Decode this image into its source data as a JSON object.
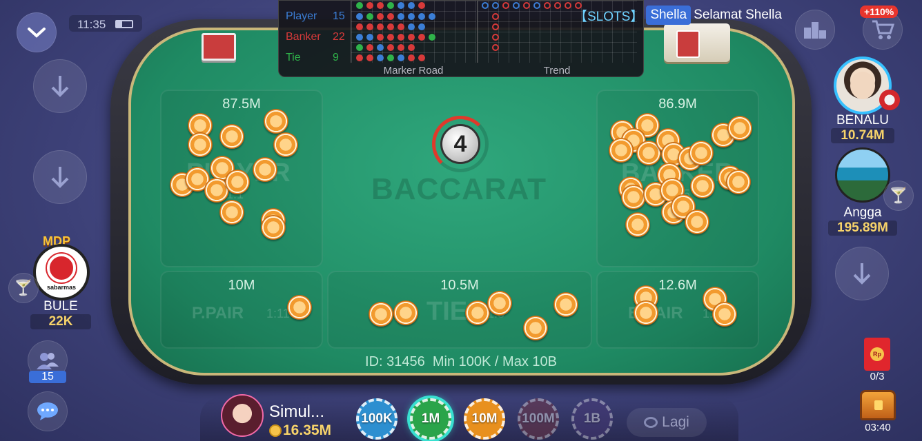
{
  "status_bar": {
    "time": "11:35"
  },
  "scoreboard": {
    "rows": [
      {
        "label": "Player",
        "count": "15",
        "color": "#3b7ed6"
      },
      {
        "label": "Banker",
        "count": "22",
        "color": "#d83a3a"
      },
      {
        "label": "Tie",
        "count": "9",
        "color": "#2fb34a"
      }
    ],
    "marker_road_label": "Marker Road",
    "trend_label": "Trend"
  },
  "announcement": {
    "tag": "【SLOTS】",
    "name": "Shella",
    "message": "Selamat Shella"
  },
  "bonus_badge": "+110%",
  "table": {
    "title": "BACCARAT",
    "countdown": "4",
    "info": "ID: 31456  Min 100K / Max 10B",
    "zones": {
      "player": {
        "amount": "87.5M",
        "label": "PLAYER",
        "odds": "1:1"
      },
      "banker": {
        "amount": "86.9M",
        "label": "BANKER",
        "odds": "1:0.95"
      },
      "p_pair": {
        "amount": "10M",
        "label": "P.PAIR",
        "odds": "1:11"
      },
      "tie": {
        "amount": "10.5M",
        "label": "TIE",
        "odds": "1:8"
      },
      "b_pair": {
        "amount": "12.6M",
        "label": "B.PAIR",
        "odds": "1:11"
      }
    }
  },
  "players": {
    "left": {
      "badge": "MDP",
      "logo_text": "sabarmas",
      "name": "BULE",
      "money": "22K"
    },
    "right_top": {
      "name": "BENALU",
      "money": "10.74M"
    },
    "right_mid": {
      "name": "Angga",
      "money": "195.89M"
    }
  },
  "online_count": "15",
  "self": {
    "name": "Simul...",
    "money": "16.35M"
  },
  "bet_chips": [
    {
      "label": "100K",
      "color": "#2d8fd0",
      "enabled": true,
      "selected": false
    },
    {
      "label": "1M",
      "color": "#2aa44a",
      "enabled": true,
      "selected": true
    },
    {
      "label": "10M",
      "color": "#e8901e",
      "enabled": true,
      "selected": false
    },
    {
      "label": "100M",
      "color": "#7a3640",
      "enabled": false,
      "selected": false
    },
    {
      "label": "1B",
      "color": "#4a3a7a",
      "enabled": false,
      "selected": false
    }
  ],
  "repeat_button": "Lagi",
  "red_packet": {
    "progress": "0/3"
  },
  "chest": {
    "timer": "03:40"
  }
}
